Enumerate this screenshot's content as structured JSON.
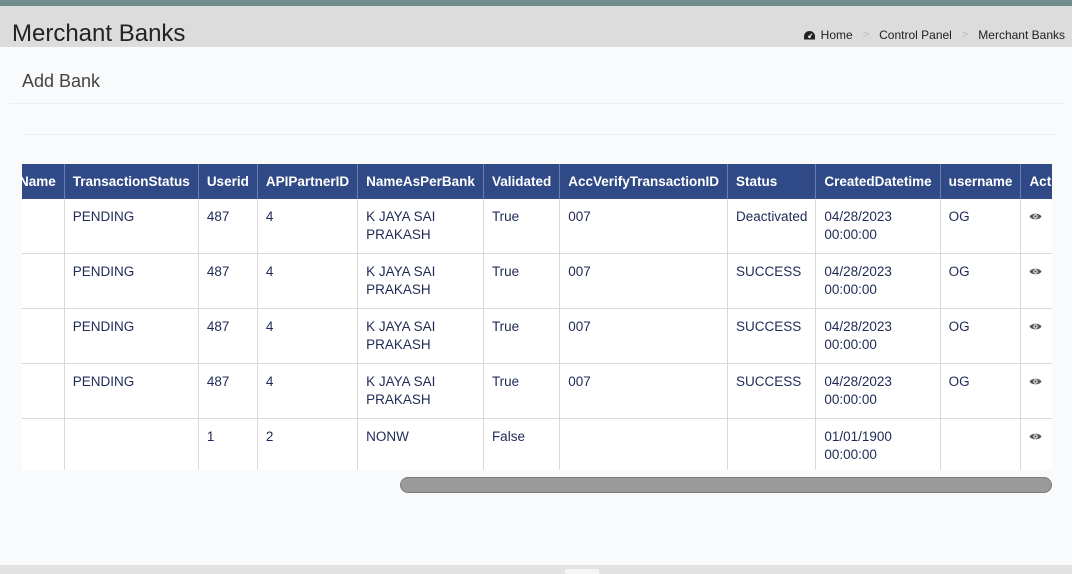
{
  "header": {
    "title": "Merchant Banks",
    "breadcrumb": [
      "Home",
      "Control Panel",
      "Merchant Banks"
    ]
  },
  "card": {
    "title": "Add Bank"
  },
  "table": {
    "columns": [
      "Name",
      "TransactionStatus",
      "Userid",
      "APIPartnerID",
      "NameAsPerBank",
      "Validated",
      "AccVerifyTransactionID",
      "Status",
      "CreatedDatetime",
      "username",
      "Action"
    ],
    "rows": [
      {
        "name": "",
        "transaction_status": "PENDING",
        "userid": "487",
        "api_partner_id": "4",
        "name_as_per_bank": "K JAYA SAI PRAKASH",
        "validated": "True",
        "acc_verify_transaction_id": "007",
        "status": "Deactivated",
        "created_datetime": "04/28/2023 00:00:00",
        "username": "OG"
      },
      {
        "name": "",
        "transaction_status": "PENDING",
        "userid": "487",
        "api_partner_id": "4",
        "name_as_per_bank": "K JAYA SAI PRAKASH",
        "validated": "True",
        "acc_verify_transaction_id": "007",
        "status": "SUCCESS",
        "created_datetime": "04/28/2023 00:00:00",
        "username": "OG"
      },
      {
        "name": "",
        "transaction_status": "PENDING",
        "userid": "487",
        "api_partner_id": "4",
        "name_as_per_bank": "K JAYA SAI PRAKASH",
        "validated": "True",
        "acc_verify_transaction_id": "007",
        "status": "SUCCESS",
        "created_datetime": "04/28/2023 00:00:00",
        "username": "OG"
      },
      {
        "name": "",
        "transaction_status": "PENDING",
        "userid": "487",
        "api_partner_id": "4",
        "name_as_per_bank": "K JAYA SAI PRAKASH",
        "validated": "True",
        "acc_verify_transaction_id": "007",
        "status": "SUCCESS",
        "created_datetime": "04/28/2023 00:00:00",
        "username": "OG"
      },
      {
        "name": "",
        "transaction_status": "",
        "userid": "1",
        "api_partner_id": "2",
        "name_as_per_bank": "NONW",
        "validated": "False",
        "acc_verify_transaction_id": "",
        "status": "",
        "created_datetime": "01/01/1900 00:00:00",
        "username": ""
      }
    ],
    "action_icon": "eye-icon"
  },
  "colors": {
    "header_bg": "#2f4a86",
    "text": "#1f2a55",
    "topbar": "#6f8d8c"
  }
}
